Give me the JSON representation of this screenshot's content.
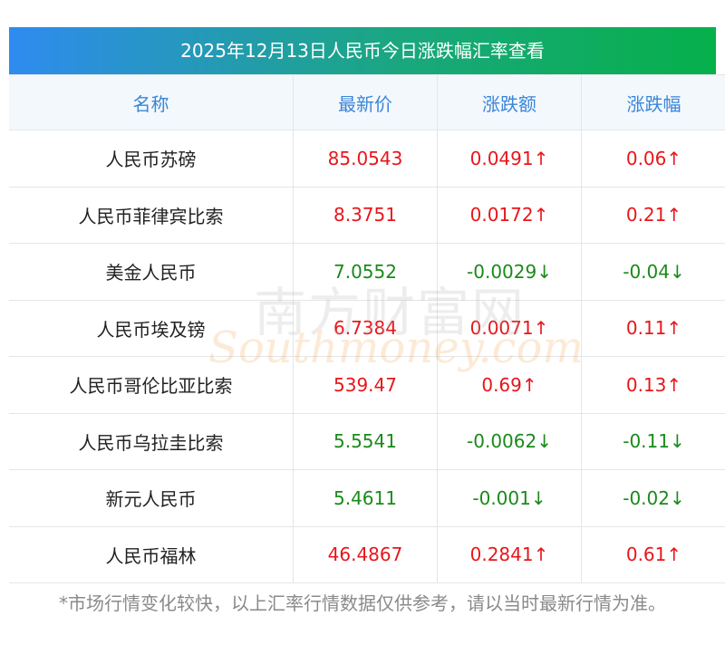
{
  "title": "2025年12月13日人民币今日涨跌幅汇率查看",
  "columns": [
    "名称",
    "最新价",
    "涨跌额",
    "涨跌幅"
  ],
  "rows": [
    {
      "name": "人民币苏磅",
      "price": "85.0543",
      "change": "0.0491↑",
      "pct": "0.06↑",
      "dir": "up"
    },
    {
      "name": "人民币菲律宾比索",
      "price": "8.3751",
      "change": "0.0172↑",
      "pct": "0.21↑",
      "dir": "up"
    },
    {
      "name": "美金人民币",
      "price": "7.0552",
      "change": "-0.0029↓",
      "pct": "-0.04↓",
      "dir": "down"
    },
    {
      "name": "人民币埃及镑",
      "price": "6.7384",
      "change": "0.0071↑",
      "pct": "0.11↑",
      "dir": "up"
    },
    {
      "name": "人民币哥伦比亚比索",
      "price": "539.47",
      "change": "0.69↑",
      "pct": "0.13↑",
      "dir": "up"
    },
    {
      "name": "人民币乌拉圭比索",
      "price": "5.5541",
      "change": "-0.0062↓",
      "pct": "-0.11↓",
      "dir": "down"
    },
    {
      "name": "新元人民币",
      "price": "5.4611",
      "change": "-0.001↓",
      "pct": "-0.02↓",
      "dir": "down"
    },
    {
      "name": "人民币福林",
      "price": "46.4867",
      "change": "0.2841↑",
      "pct": "0.61↑",
      "dir": "up"
    }
  ],
  "note": "*市场行情变化较快，以上汇率行情数据仅供参考，请以当时最新行情为准。",
  "watermark": {
    "cn": "南方财富网",
    "en": "Southmoney.com"
  },
  "colors": {
    "up": "#e8161b",
    "down": "#1a8a1a",
    "header_text": "#3a86d8"
  }
}
